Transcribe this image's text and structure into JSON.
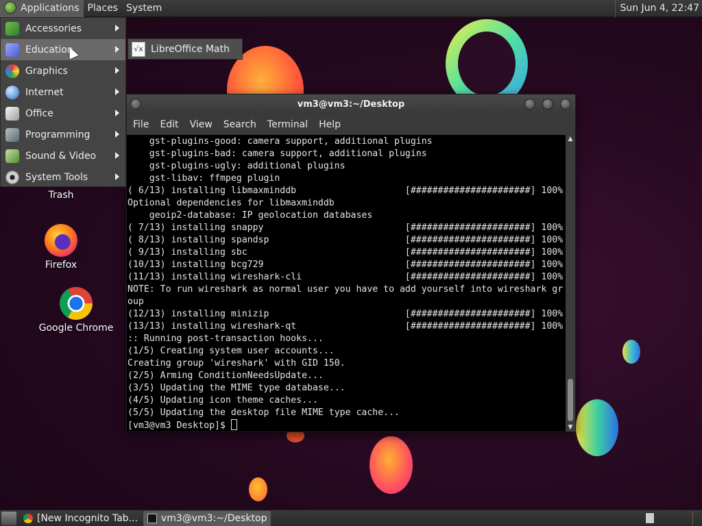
{
  "top_panel": {
    "menus": [
      "Applications",
      "Places",
      "System"
    ],
    "clock": "Sun Jun  4, 22:47"
  },
  "app_menu": {
    "items": [
      {
        "label": "Accessories",
        "icon": "accessories-icon"
      },
      {
        "label": "Education",
        "icon": "education-icon"
      },
      {
        "label": "Graphics",
        "icon": "graphics-icon"
      },
      {
        "label": "Internet",
        "icon": "internet-icon"
      },
      {
        "label": "Office",
        "icon": "office-icon"
      },
      {
        "label": "Programming",
        "icon": "programming-icon"
      },
      {
        "label": "Sound & Video",
        "icon": "sound-video-icon"
      },
      {
        "label": "System Tools",
        "icon": "system-tools-icon"
      }
    ],
    "highlighted": "Education",
    "submenu": {
      "label": "LibreOffice Math",
      "icon": "libreoffice-math-icon",
      "icon_glyph": "√x"
    }
  },
  "desktop_icons": [
    {
      "label": "Trash"
    },
    {
      "label": "Firefox"
    },
    {
      "label": "Google Chrome"
    }
  ],
  "terminal": {
    "title": "vm3@vm3:~/Desktop",
    "menu": [
      "File",
      "Edit",
      "View",
      "Search",
      "Terminal",
      "Help"
    ],
    "lines": [
      "    gst-plugins-good: camera support, additional plugins",
      "    gst-plugins-bad: camera support, additional plugins",
      "    gst-plugins-ugly: additional plugins",
      "    gst-libav: ffmpeg plugin",
      "( 6/13) installing libmaxminddb                    [######################] 100%",
      "Optional dependencies for libmaxminddb",
      "    geoip2-database: IP geolocation databases",
      "( 7/13) installing snappy                          [######################] 100%",
      "( 8/13) installing spandsp                         [######################] 100%",
      "( 9/13) installing sbc                             [######################] 100%",
      "(10/13) installing bcg729                          [######################] 100%",
      "(11/13) installing wireshark-cli                   [######################] 100%",
      "NOTE: To run wireshark as normal user you have to add yourself into wireshark gr",
      "oup",
      "(12/13) installing minizip                         [######################] 100%",
      "(13/13) installing wireshark-qt                    [######################] 100%",
      ":: Running post-transaction hooks...",
      "(1/5) Creating system user accounts...",
      "Creating group 'wireshark' with GID 150.",
      "(2/5) Arming ConditionNeedsUpdate...",
      "(3/5) Updating the MIME type database...",
      "(4/5) Updating icon theme caches...",
      "(5/5) Updating the desktop file MIME type cache..."
    ],
    "prompt": "[vm3@vm3 Desktop]$ "
  },
  "taskbar": {
    "tasks": [
      {
        "label": "[New Incognito Tab...",
        "icon": "chrome-icon"
      },
      {
        "label": "vm3@vm3:~/Desktop",
        "icon": "terminal-icon"
      }
    ]
  },
  "colors": {
    "desktop_bg": "#2a0d24",
    "panel_bg": "#333333",
    "terminal_bg": "#000000",
    "terminal_fg": "#e6e6e6"
  }
}
